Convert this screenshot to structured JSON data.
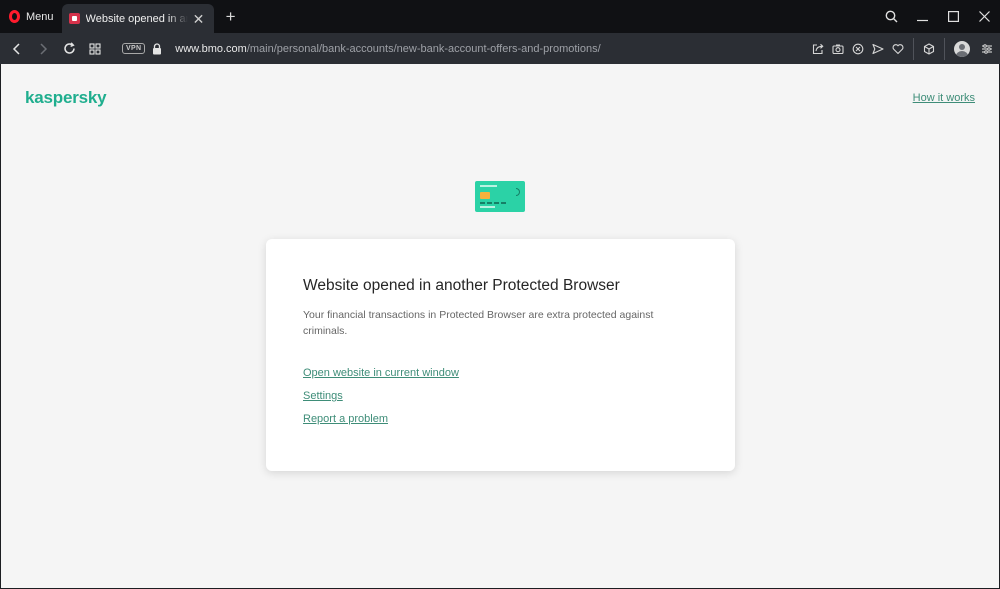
{
  "browser": {
    "menu_label": "Menu",
    "tab": {
      "title": "Website opened in another Protected Browser"
    },
    "address": {
      "vpn_label": "VPN",
      "url_domain": "www.bmo.com",
      "url_path": "/main/personal/bank-accounts/new-bank-account-offers-and-promotions/"
    }
  },
  "page": {
    "brand": "kaspersky",
    "how_it_works": "How it works",
    "title": "Website opened in another Protected Browser",
    "description": "Your financial transactions in Protected Browser are extra protected against criminals.",
    "links": {
      "open_here": "Open website in current window",
      "settings": "Settings",
      "report": "Report a problem"
    }
  },
  "colors": {
    "brand": "#1fae8e",
    "link": "#3e8d78",
    "card": "#2bd2a6",
    "opera_red": "#ff1b2d"
  },
  "icons": [
    "opera-logo-icon",
    "close-icon",
    "plus-icon",
    "search-icon",
    "minimize-icon",
    "maximize-icon",
    "back-icon",
    "forward-icon",
    "reload-icon",
    "tab-grid-icon",
    "lock-icon",
    "share-icon",
    "camera-icon",
    "adblock-icon",
    "send-icon",
    "heart-icon",
    "cube-icon",
    "avatar-icon",
    "settings-sliders-icon",
    "credit-card-icon"
  ]
}
